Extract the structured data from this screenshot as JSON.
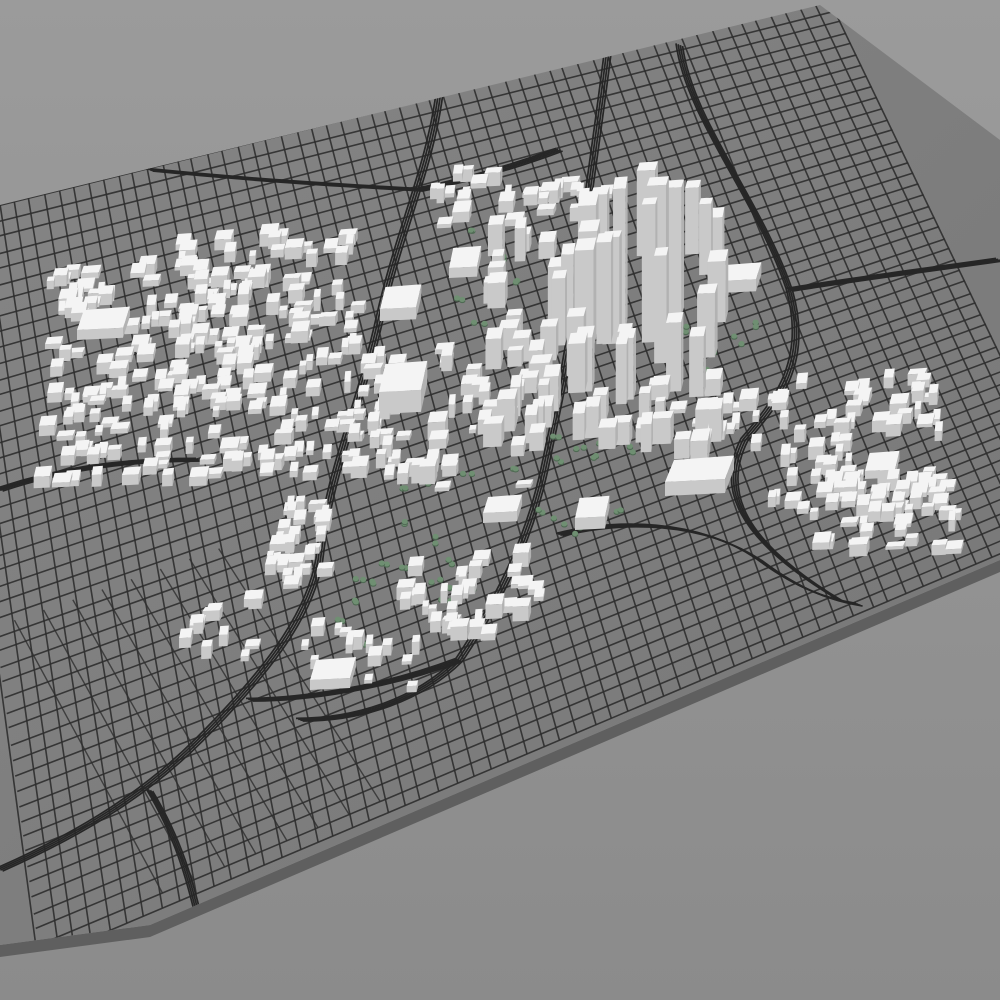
{
  "scene": {
    "subject": "3d-city-model-render",
    "colors": {
      "backdrop_top": "#9a9a9a",
      "backdrop_bottom": "#8c8c8c",
      "board_top": "#7f7f7f",
      "board_edge": "#6e6e6e",
      "board_side": "#5e5e5e",
      "street": "#2e2e2e",
      "highway": "#262626",
      "building_top": "#f4f4f4",
      "building_side": "#c9c9c9",
      "building_shade": "#b2b2b2",
      "tree": "#6f8f72",
      "tree_dark": "#4f6a53"
    }
  }
}
